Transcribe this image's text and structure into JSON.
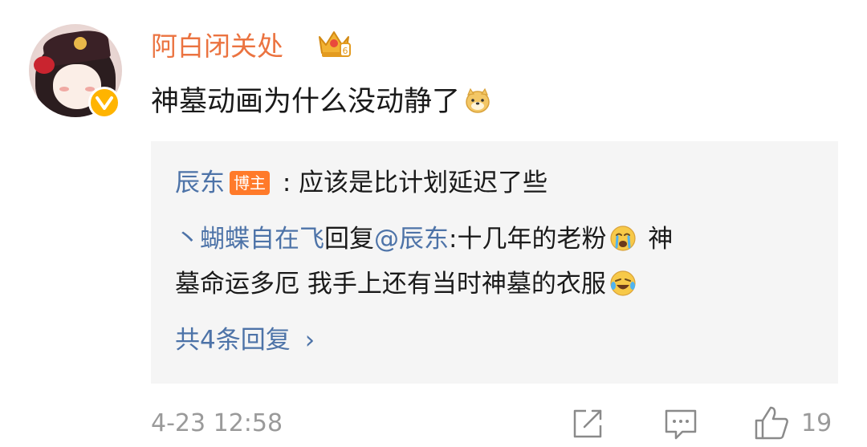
{
  "comment": {
    "username": "阿白闭关处",
    "text": "神墓动画为什么没动静了",
    "avatar_icon": "anime-girl-avatar",
    "verified_icon": "verified-v-badge",
    "level_icon": "crown-level-6"
  },
  "replies": [
    {
      "author": "辰东",
      "badge": "博主",
      "separator": " : ",
      "text": "应该是比计划延迟了些"
    },
    {
      "prefix": "丶蝴蝶自在飞",
      "reply_word": "回复",
      "mention": "@辰东",
      "colon": ":",
      "text_line1": "十几年的老粉",
      "text_line1_after": " 神",
      "text_line2": "墓命运多厄  我手上还有当时神墓的衣服"
    }
  ],
  "more_replies": {
    "label": "共4条回复",
    "chevron": "›"
  },
  "footer": {
    "timestamp": "4-23 12:58",
    "like_count": "19"
  },
  "colors": {
    "username": "#eb7340",
    "link_blue": "#4d73a8",
    "reply_bg": "#f5f5f5",
    "meta_gray": "#9a9a9a",
    "badge_bg": "#ff7a2a"
  }
}
